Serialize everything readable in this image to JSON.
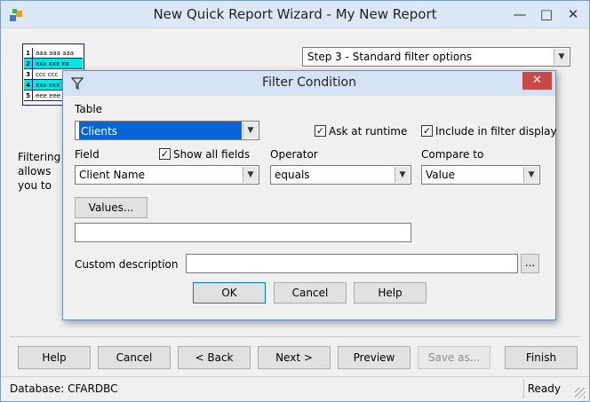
{
  "window": {
    "title": "New Quick Report Wizard - My New Report"
  },
  "wizard": {
    "step_select": "Step 3 - Standard filter options",
    "description": "Filtering allows you to specify which records appear in",
    "report_rows": [
      {
        "num": "1",
        "text": "aaa aaa aaa"
      },
      {
        "num": "2",
        "text": "xxx xxx xx"
      },
      {
        "num": "3",
        "text": "ccc ccc"
      },
      {
        "num": "4",
        "text": "xxx xxx"
      },
      {
        "num": "5",
        "text": "eee eee"
      }
    ],
    "buttons": {
      "help": "Help",
      "cancel": "Cancel",
      "back": "< Back",
      "next": "Next >",
      "preview": "Preview",
      "save_as": "Save as...",
      "finish": "Finish"
    }
  },
  "status": {
    "database": "Database: CFARDBC",
    "state": "Ready"
  },
  "dialog": {
    "title": "Filter Condition",
    "table_label": "Table",
    "table_value": "Clients",
    "ask_runtime_label": "Ask at runtime",
    "include_filter_label": "Include in filter display",
    "field_label": "Field",
    "show_all_fields_label": "Show all fields",
    "field_value": "Client Name",
    "operator_label": "Operator",
    "operator_value": "equals",
    "compare_label": "Compare to",
    "compare_value": "Value",
    "values_button": "Values...",
    "values_text": "",
    "custom_desc_label": "Custom description",
    "custom_desc_value": "",
    "browse_button": "...",
    "ok": "OK",
    "cancel": "Cancel",
    "help": "Help"
  },
  "colors": {
    "selection": "#0a64d6",
    "close_button": "#c74a44",
    "report_highlight": "#00e5e5"
  }
}
